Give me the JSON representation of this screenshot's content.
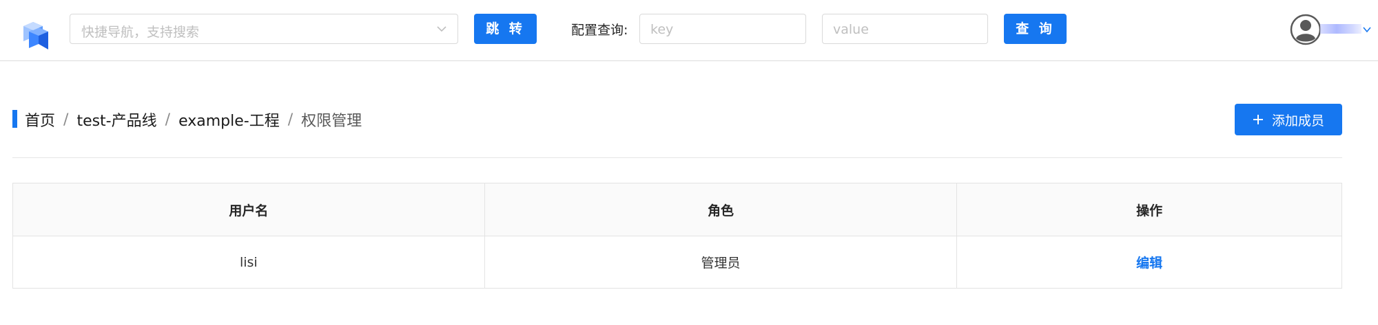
{
  "header": {
    "nav_placeholder": "快捷导航，支持搜索",
    "jump_label": "跳 转",
    "config_label": "配置查询:",
    "key_placeholder": "key",
    "value_placeholder": "value",
    "query_label": "查 询"
  },
  "breadcrumb": {
    "items": [
      "首页",
      "test-产品线",
      "example-工程"
    ],
    "separator": "/",
    "current": "权限管理"
  },
  "actions": {
    "add_member_label": "添加成员"
  },
  "table": {
    "columns": [
      "用户名",
      "角色",
      "操作"
    ],
    "rows": [
      {
        "username": "lisi",
        "role": "管理员",
        "action": "编辑"
      }
    ]
  },
  "colors": {
    "primary": "#1677f0",
    "border": "#e3e3e3",
    "header_bg": "#fafafa"
  },
  "icons": [
    "app-logo-icon",
    "chevron-down-icon",
    "avatar-icon",
    "plus-icon"
  ]
}
